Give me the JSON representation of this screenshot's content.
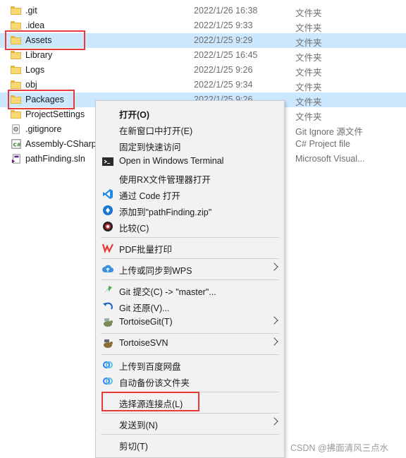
{
  "files": [
    {
      "name": ".git",
      "date": "2022/1/26 16:38",
      "type": "文件夹",
      "icon": "folder-icon"
    },
    {
      "name": ".idea",
      "date": "2022/1/25 9:33",
      "type": "文件夹",
      "icon": "folder-icon"
    },
    {
      "name": "Assets",
      "date": "2022/1/25 9:29",
      "type": "文件夹",
      "icon": "folder-icon"
    },
    {
      "name": "Library",
      "date": "2022/1/25 16:45",
      "type": "文件夹",
      "icon": "folder-icon"
    },
    {
      "name": "Logs",
      "date": "2022/1/25 9:26",
      "type": "文件夹",
      "icon": "folder-icon"
    },
    {
      "name": "obj",
      "date": "2022/1/25 9:34",
      "type": "文件夹",
      "icon": "folder-icon"
    },
    {
      "name": "Packages",
      "date": "2022/1/25 9:26",
      "type": "文件夹",
      "icon": "folder-icon"
    },
    {
      "name": "ProjectSettings",
      "date": "",
      "type": "文件夹",
      "icon": "folder-icon"
    },
    {
      "name": ".gitignore",
      "date": "",
      "type": "Git Ignore 源文件",
      "icon": "gitignore-file-icon"
    },
    {
      "name": "Assembly-CSharp",
      "date": "",
      "type": "C# Project file",
      "icon": "csharp-project-icon"
    },
    {
      "name": "pathFinding.sln",
      "date": "",
      "type": "Microsoft Visual...",
      "icon": "sln-file-icon"
    }
  ],
  "menu": {
    "open": "打开(O)",
    "open_new_window": "在新窗口中打开(E)",
    "pin_quick_access": "固定到快速访问",
    "open_terminal": "Open in Windows Terminal",
    "open_rx": "使用RX文件管理器打开",
    "open_vscode": "通过 Code 打开",
    "add_to_zip": "添加到\"pathFinding.zip\"",
    "compare": "比较(C)",
    "pdf_print": "PDF批量打印",
    "upload_wps": "上传或同步到WPS",
    "git_commit": "Git 提交(C) -> \"master\"...",
    "git_revert": "Git 还原(V)...",
    "tortoisegit": "TortoiseGit(T)",
    "tortoisesvn": "TortoiseSVN",
    "upload_baidu": "上传到百度网盘",
    "auto_backup": "自动备份该文件夹",
    "select_link_source": "选择源连接点(L)",
    "send_to": "发送到(N)",
    "cut": "剪切(T)"
  },
  "watermark": "CSDN @拂面清风三点水",
  "colors": {
    "selection": "#cce8ff",
    "highlight_box": "#e53b3b",
    "menu_bg": "#f2f2f2"
  }
}
